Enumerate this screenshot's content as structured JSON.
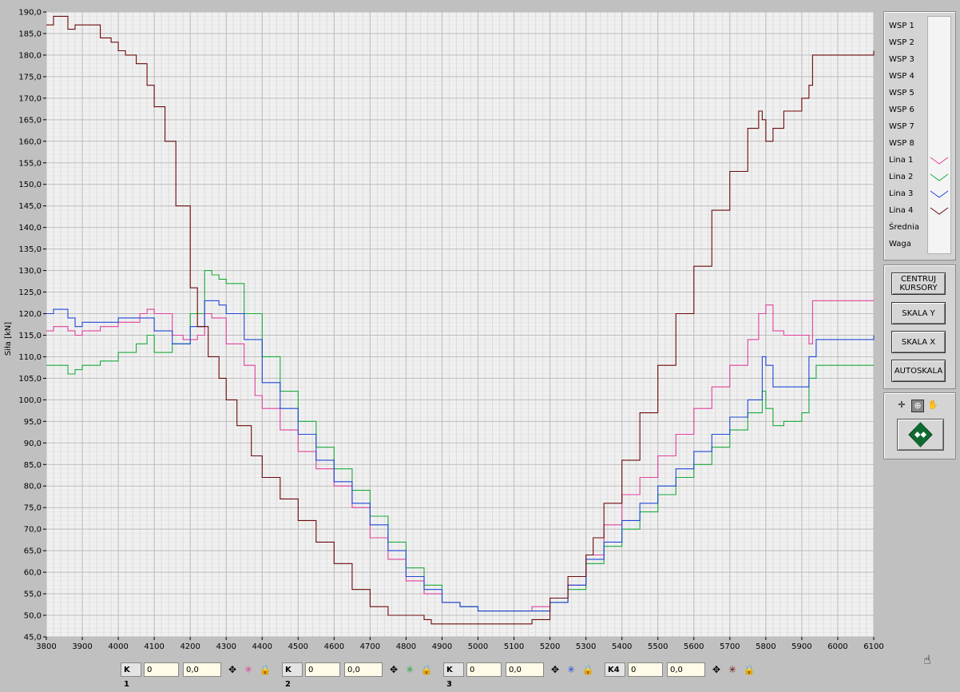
{
  "chart_data": {
    "type": "line",
    "ylabel": "Siła [kN]",
    "xlim": [
      3800,
      6100
    ],
    "ylim": [
      45,
      190
    ],
    "xticks": [
      "3800",
      "3900",
      "4000",
      "4100",
      "4200",
      "4300",
      "4400",
      "4500",
      "4600",
      "4700",
      "4800",
      "4900",
      "5000",
      "5100",
      "5200",
      "5300",
      "5400",
      "5500",
      "5600",
      "5700",
      "5800",
      "5900",
      "6000",
      "6100"
    ],
    "yticks": [
      "45,0",
      "50,0",
      "55,0",
      "60,0",
      "65,0",
      "70,0",
      "75,0",
      "80,0",
      "85,0",
      "90,0",
      "95,0",
      "100,0",
      "105,0",
      "110,0",
      "115,0",
      "120,0",
      "125,0",
      "130,0",
      "135,0",
      "140,0",
      "145,0",
      "150,0",
      "155,0",
      "160,0",
      "165,0",
      "170,0",
      "175,0",
      "180,0",
      "185,0",
      "190,0"
    ],
    "grid": true,
    "series": [
      {
        "name": "Lina 1",
        "color": "#e0409a",
        "x": [
          3800,
          3820,
          3860,
          3880,
          3900,
          3950,
          4000,
          4060,
          4080,
          4100,
          4150,
          4180,
          4220,
          4240,
          4260,
          4300,
          4350,
          4380,
          4400,
          4450,
          4500,
          4550,
          4600,
          4650,
          4700,
          4750,
          4800,
          4850,
          4900,
          4950,
          5000,
          5050,
          5100,
          5150,
          5200,
          5250,
          5300,
          5350,
          5400,
          5450,
          5500,
          5550,
          5600,
          5650,
          5700,
          5750,
          5780,
          5800,
          5820,
          5850,
          5900,
          5920,
          5930,
          6000,
          6100
        ],
        "y": [
          116,
          117,
          116,
          115,
          116,
          117,
          118,
          120,
          121,
          120,
          115,
          114,
          115,
          120,
          119,
          113,
          108,
          101,
          98,
          93,
          88,
          84,
          80,
          75,
          68,
          63,
          58,
          55,
          53,
          52,
          51,
          51,
          51,
          52,
          53,
          57,
          64,
          71,
          78,
          82,
          87,
          92,
          98,
          103,
          108,
          114,
          120,
          122,
          116,
          115,
          115,
          113,
          123,
          123,
          123
        ]
      },
      {
        "name": "Lina 2",
        "color": "#1aaa3a",
        "x": [
          3800,
          3820,
          3860,
          3880,
          3900,
          3950,
          4000,
          4050,
          4080,
          4100,
          4150,
          4200,
          4240,
          4260,
          4280,
          4300,
          4350,
          4400,
          4450,
          4500,
          4550,
          4600,
          4650,
          4700,
          4750,
          4800,
          4850,
          4900,
          4950,
          5000,
          5050,
          5100,
          5150,
          5200,
          5250,
          5300,
          5350,
          5400,
          5450,
          5500,
          5550,
          5600,
          5650,
          5700,
          5750,
          5790,
          5800,
          5820,
          5850,
          5900,
          5920,
          5940,
          6000,
          6100
        ],
        "y": [
          108,
          108,
          106,
          107,
          108,
          109,
          111,
          113,
          115,
          111,
          113,
          120,
          130,
          129,
          128,
          127,
          120,
          110,
          102,
          95,
          89,
          84,
          79,
          73,
          67,
          61,
          57,
          53,
          52,
          51,
          51,
          51,
          51,
          53,
          56,
          62,
          66,
          70,
          74,
          78,
          82,
          85,
          89,
          93,
          97,
          102,
          98,
          94,
          95,
          97,
          105,
          108,
          108,
          108
        ]
      },
      {
        "name": "Lina 3",
        "color": "#1f47d6",
        "x": [
          3800,
          3820,
          3860,
          3880,
          3900,
          3950,
          4000,
          4060,
          4080,
          4100,
          4150,
          4200,
          4240,
          4260,
          4280,
          4300,
          4350,
          4400,
          4450,
          4500,
          4550,
          4600,
          4650,
          4700,
          4750,
          4800,
          4850,
          4900,
          4950,
          5000,
          5050,
          5100,
          5150,
          5200,
          5250,
          5300,
          5350,
          5400,
          5450,
          5500,
          5550,
          5600,
          5650,
          5700,
          5750,
          5790,
          5800,
          5820,
          5850,
          5900,
          5920,
          5940,
          6000,
          6100
        ],
        "y": [
          120,
          121,
          119,
          117,
          118,
          118,
          119,
          119,
          119,
          116,
          113,
          117,
          123,
          123,
          122,
          120,
          114,
          104,
          98,
          92,
          86,
          81,
          76,
          71,
          65,
          59,
          56,
          53,
          52,
          51,
          51,
          51,
          51,
          53,
          57,
          63,
          67,
          72,
          76,
          80,
          84,
          88,
          92,
          96,
          100,
          110,
          108,
          103,
          103,
          103,
          110,
          114,
          114,
          115
        ]
      },
      {
        "name": "Lina 4",
        "color": "#6b0a0a",
        "x": [
          3800,
          3820,
          3850,
          3860,
          3880,
          3900,
          3950,
          3980,
          4000,
          4020,
          4050,
          4080,
          4100,
          4130,
          4160,
          4200,
          4220,
          4250,
          4280,
          4300,
          4330,
          4370,
          4400,
          4450,
          4500,
          4550,
          4600,
          4650,
          4700,
          4750,
          4800,
          4850,
          4870,
          4900,
          4950,
          5000,
          5050,
          5100,
          5130,
          5150,
          5200,
          5250,
          5300,
          5320,
          5350,
          5400,
          5450,
          5500,
          5550,
          5600,
          5650,
          5700,
          5750,
          5780,
          5790,
          5800,
          5820,
          5850,
          5900,
          5920,
          5930,
          6000,
          6050,
          6100
        ],
        "y": [
          187,
          189,
          189,
          186,
          187,
          187,
          184,
          183,
          181,
          180,
          178,
          173,
          168,
          160,
          145,
          126,
          117,
          110,
          105,
          100,
          94,
          87,
          82,
          77,
          72,
          67,
          62,
          56,
          52,
          50,
          50,
          49,
          48,
          48,
          48,
          48,
          48,
          48,
          48,
          49,
          54,
          59,
          64,
          68,
          76,
          86,
          97,
          108,
          120,
          131,
          144,
          153,
          163,
          167,
          165,
          160,
          163,
          167,
          170,
          173,
          180,
          180,
          180,
          181
        ]
      }
    ]
  },
  "legend": {
    "items": [
      "WSP 1",
      "WSP 2",
      "WSP 3",
      "WSP 4",
      "WSP 5",
      "WSP 6",
      "WSP 7",
      "WSP 8",
      "Lina 1",
      "Lina 2",
      "Lina 3",
      "Lina 4",
      "Średnia",
      "Waga"
    ]
  },
  "buttons": {
    "center_cursors": "CENTRUJ KURSORY",
    "scale_y": "SKALA Y",
    "scale_x": "SKALA X",
    "autoscale": "AUTOSKALA"
  },
  "cursors": [
    {
      "label": "K 1",
      "x": "0",
      "y": "0,0",
      "color": "#e0409a"
    },
    {
      "label": "K 2",
      "x": "0",
      "y": "0,0",
      "color": "#1aaa3a"
    },
    {
      "label": "K 3",
      "x": "0",
      "y": "0,0",
      "color": "#1f47d6"
    },
    {
      "label": "K4",
      "x": "0",
      "y": "0,0",
      "color": "#6b0a0a"
    }
  ]
}
